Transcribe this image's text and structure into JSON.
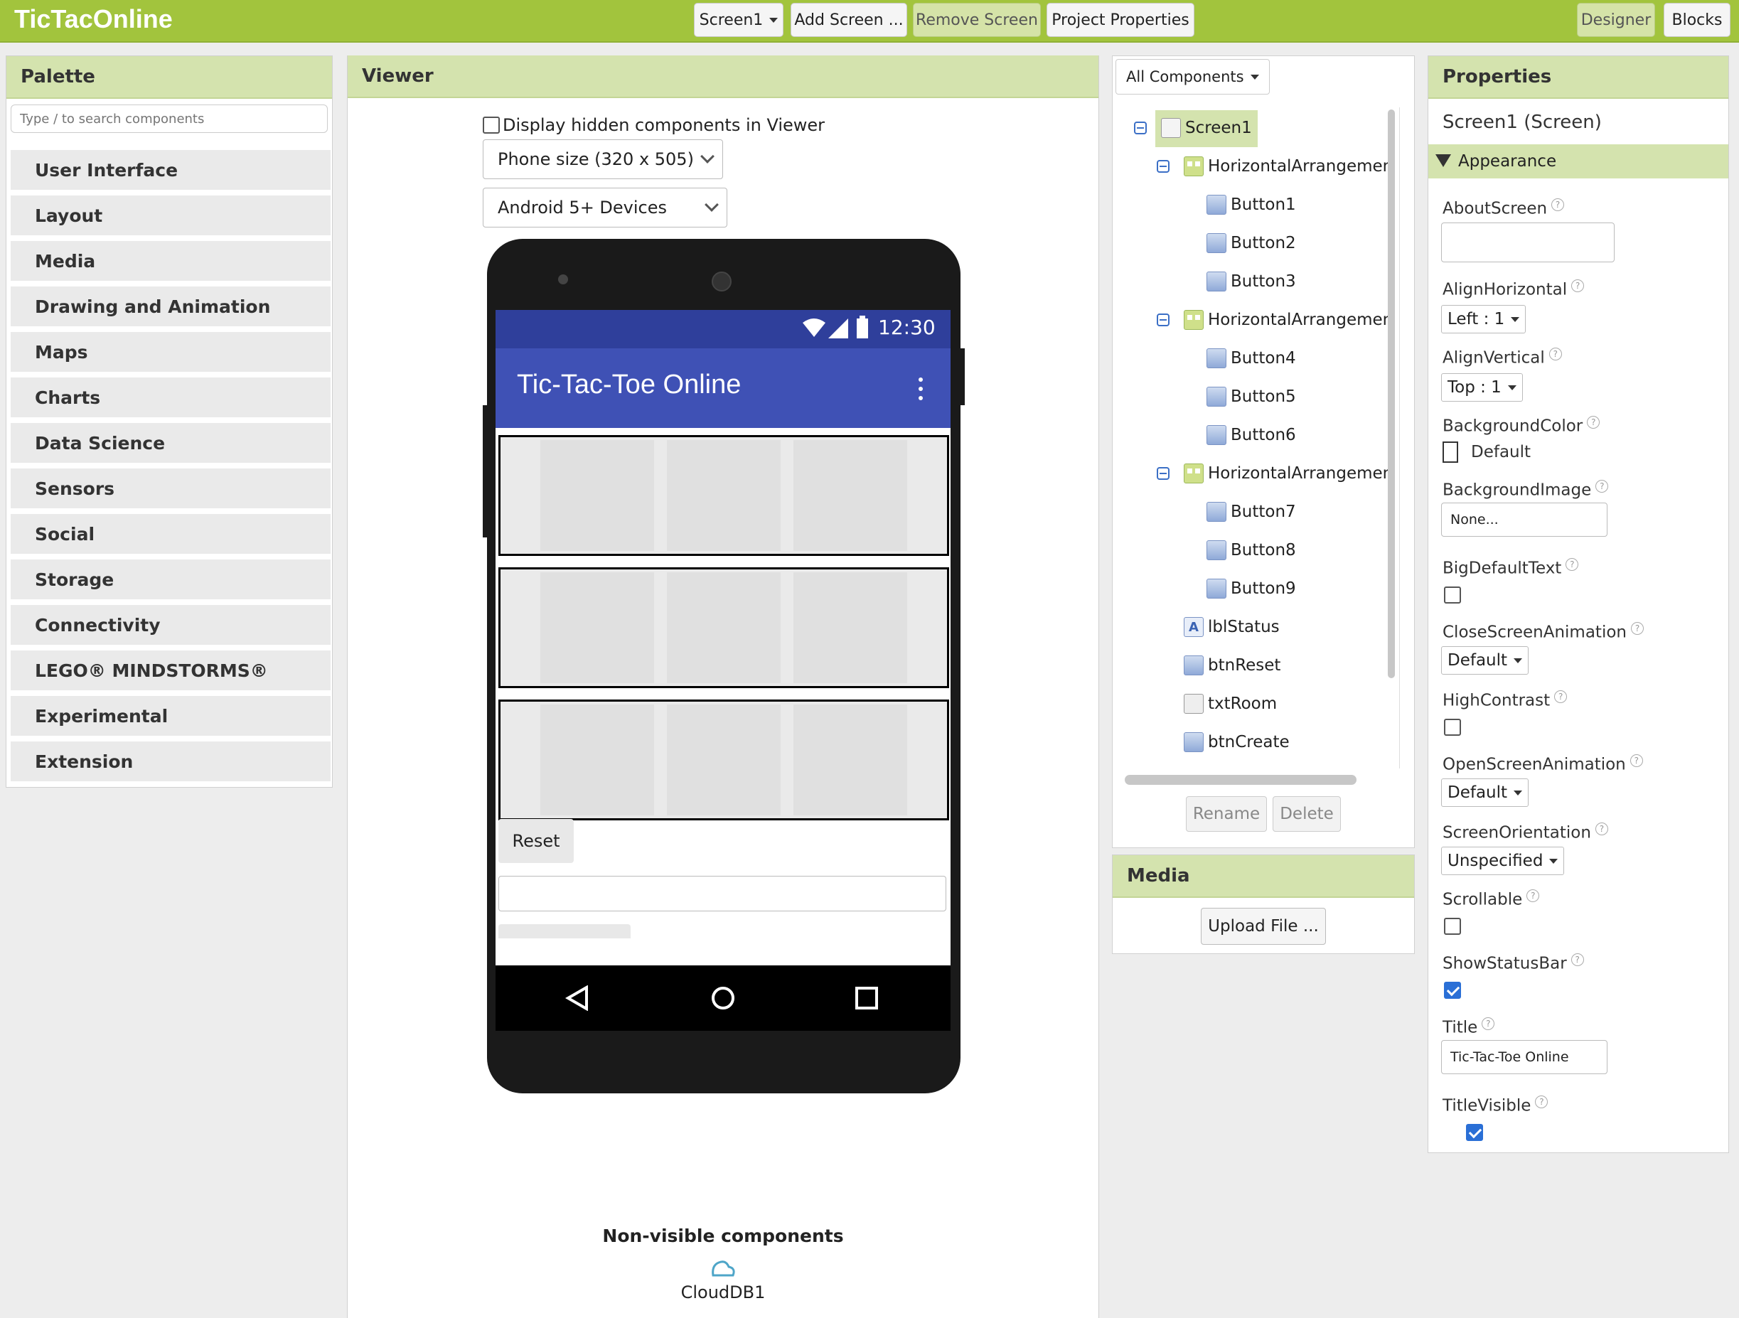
{
  "app_title": "TicTacOnline",
  "toolbar": {
    "screen_select": "Screen1",
    "add_screen": "Add Screen ...",
    "remove_screen": "Remove Screen",
    "project_properties": "Project Properties",
    "designer": "Designer",
    "blocks": "Blocks"
  },
  "palette": {
    "title": "Palette",
    "search_placeholder": "Type / to search components",
    "categories": [
      "User Interface",
      "Layout",
      "Media",
      "Drawing and Animation",
      "Maps",
      "Charts",
      "Data Science",
      "Sensors",
      "Social",
      "Storage",
      "Connectivity",
      "LEGO® MINDSTORMS®",
      "Experimental",
      "Extension"
    ]
  },
  "viewer": {
    "title": "Viewer",
    "show_hidden_label": "Display hidden components in Viewer",
    "phone_size": "Phone size (320 x 505)",
    "device": "Android 5+ Devices",
    "status_time": "12:30",
    "app_heading": "Tic-Tac-Toe Online",
    "reset_label": "Reset",
    "nonvisible_title": "Non-visible components",
    "nonvisible_items": [
      "CloudDB1"
    ]
  },
  "components": {
    "filter": "All Components",
    "tree": [
      {
        "label": "Screen1",
        "level": 0,
        "icon": "screen-icon",
        "toggle": true,
        "selected": true
      },
      {
        "label": "HorizontalArrangemen",
        "level": 1,
        "icon": "horizontal-arrangement-icon",
        "toggle": true
      },
      {
        "label": "Button1",
        "level": 2,
        "icon": "button-icon"
      },
      {
        "label": "Button2",
        "level": 2,
        "icon": "button-icon"
      },
      {
        "label": "Button3",
        "level": 2,
        "icon": "button-icon"
      },
      {
        "label": "HorizontalArrangemen",
        "level": 1,
        "icon": "horizontal-arrangement-icon",
        "toggle": true
      },
      {
        "label": "Button4",
        "level": 2,
        "icon": "button-icon"
      },
      {
        "label": "Button5",
        "level": 2,
        "icon": "button-icon"
      },
      {
        "label": "Button6",
        "level": 2,
        "icon": "button-icon"
      },
      {
        "label": "HorizontalArrangemen",
        "level": 1,
        "icon": "horizontal-arrangement-icon",
        "toggle": true
      },
      {
        "label": "Button7",
        "level": 2,
        "icon": "button-icon"
      },
      {
        "label": "Button8",
        "level": 2,
        "icon": "button-icon"
      },
      {
        "label": "Button9",
        "level": 2,
        "icon": "button-icon"
      },
      {
        "label": "lblStatus",
        "level": 1,
        "icon": "label-icon"
      },
      {
        "label": "btnReset",
        "level": 1,
        "icon": "button-icon"
      },
      {
        "label": "txtRoom",
        "level": 1,
        "icon": "textbox-icon"
      },
      {
        "label": "btnCreate",
        "level": 1,
        "icon": "button-icon"
      }
    ],
    "rename": "Rename",
    "delete": "Delete"
  },
  "media": {
    "title": "Media",
    "upload": "Upload File ..."
  },
  "properties": {
    "title": "Properties",
    "component": "Screen1 (Screen)",
    "section": "Appearance",
    "about_screen": "AboutScreen",
    "align_horizontal": "AlignHorizontal",
    "align_horizontal_value": "Left : 1",
    "align_vertical": "AlignVertical",
    "align_vertical_value": "Top : 1",
    "background_color": "BackgroundColor",
    "background_color_value": "Default",
    "background_image": "BackgroundImage",
    "background_image_value": "None...",
    "big_default_text": "BigDefaultText",
    "close_screen_animation": "CloseScreenAnimation",
    "close_screen_animation_value": "Default",
    "high_contrast": "HighContrast",
    "open_screen_animation": "OpenScreenAnimation",
    "open_screen_animation_value": "Default",
    "screen_orientation": "ScreenOrientation",
    "screen_orientation_value": "Unspecified",
    "scrollable": "Scrollable",
    "show_status_bar": "ShowStatusBar",
    "title_label": "Title",
    "title_value": "Tic-Tac-Toe Online",
    "title_visible": "TitleVisible",
    "help_glyph": "?"
  },
  "colors": {
    "accent": "#a2c43d",
    "panel_header": "#d4e3ae",
    "app_bar": "#3f51b5",
    "status_bar": "#2f3f9b",
    "checkbox_on": "#2a6fd6"
  }
}
